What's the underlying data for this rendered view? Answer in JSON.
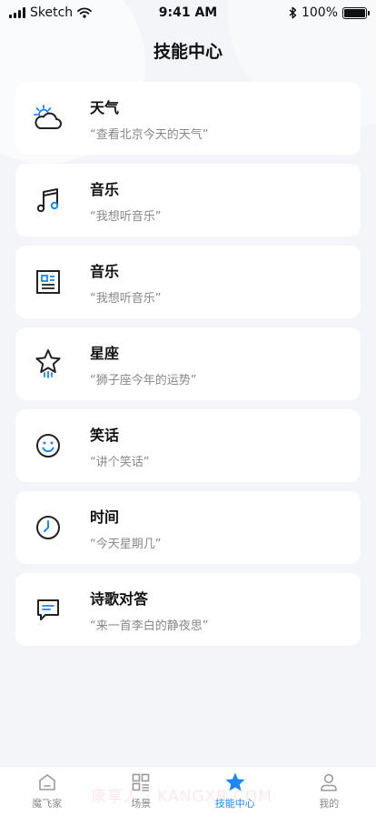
{
  "status_bar": {
    "carrier": "Sketch",
    "time": "9:41 AM",
    "battery": "100%"
  },
  "page_title": "技能中心",
  "skills": [
    {
      "icon": "weather-icon",
      "title": "天气",
      "example": "“查看北京今天的天气”"
    },
    {
      "icon": "music-note-icon",
      "title": "音乐",
      "example": "“我想听音乐”"
    },
    {
      "icon": "news-icon",
      "title": "音乐",
      "example": "“我想听音乐”"
    },
    {
      "icon": "star-icon",
      "title": "星座",
      "example": "“狮子座今年的运势”"
    },
    {
      "icon": "smiley-icon",
      "title": "笑话",
      "example": "“讲个笑话”"
    },
    {
      "icon": "clock-icon",
      "title": "时间",
      "example": "“今天星期几”"
    },
    {
      "icon": "chat-icon",
      "title": "诗歌对答",
      "example": "“来一首李白的静夜思”"
    }
  ],
  "tabbar": {
    "items": [
      {
        "icon": "home-icon",
        "label": "魔飞家",
        "active": false
      },
      {
        "icon": "scene-icon",
        "label": "场景",
        "active": false
      },
      {
        "icon": "star-filled-icon",
        "label": "技能中心",
        "active": true
      },
      {
        "icon": "profile-icon",
        "label": "我的",
        "active": false
      }
    ]
  },
  "watermark": "康享人 · KANGXR.COM",
  "colors": {
    "accent": "#1f86f5",
    "icon_dark": "#222222",
    "background": "#f3f5f8"
  }
}
